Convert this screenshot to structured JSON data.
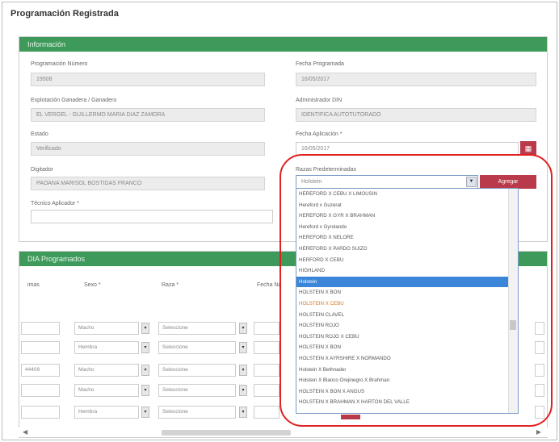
{
  "page_title": "Programación Registrada",
  "panel1_title": "Información",
  "panel2_title": "DIA Programados",
  "fields": {
    "prog_num_label": "Programación Número",
    "prog_num_value": "19508",
    "fecha_prog_label": "Fecha Programada",
    "fecha_prog_value": "16/05/2017",
    "explotacion_label": "Explotación Ganadera / Ganadero",
    "explotacion_value": "EL VERGEL - GUILLERMO MARIA DIAZ ZAMORA",
    "admin_label": "Administrador DIN",
    "admin_value": "IDENTIFICA AUTOTUTORADO",
    "estado_label": "Estado",
    "estado_value": "Verificado",
    "fecha_aplic_label": "Fecha Aplicación *",
    "fecha_aplic_value": "16/05/2017",
    "digitador_label": "Digitador",
    "digitador_value": "PAOANA MARISOL BOSTIDAS FRANCO",
    "razas_label": "Razas Predeterminadas",
    "razas_value": "Holstein",
    "agregar_label": "Agregar",
    "tecnico_label": "Técnico Aplicador *",
    "tecnico_value": ""
  },
  "breed_options": [
    "HEREFORD X CEBU X LIMOUSIN",
    "Hereford x Guzerat",
    "HEREFORD X GYR X BRAHMAN",
    "Hereford x Gyrolando",
    "HEREFORD X NELORE",
    "HEREFORD X PARDO SUIZO",
    "HERFORD X CEBU",
    "HIGHLAND",
    "Holstein",
    "HOLSTEIN X BON",
    "HOLSTEIN X CEBU",
    "HOLSTEIN CLAVEL",
    "HOLSTEIN ROJO",
    "HOLSTEIN ROJO X CEBU",
    "HOLSTEIN X BON",
    "HOLSTEIN X AYRSHIRE X NORMANDO",
    "Holstein X Bethnader",
    "Holstein X Blanco Orejinegro X Brahman",
    "HOLSTEIN X BON X ANGUS",
    "HOLSTEIN X BRAHMAN X HARTON DEL VALLE"
  ],
  "table": {
    "headers": [
      "imas",
      "Sexo *",
      "Raza *",
      "Fecha Na"
    ],
    "rows": [
      {
        "id": "",
        "sexo": "Macho",
        "raza": "Seleccione"
      },
      {
        "id": "",
        "sexo": "Hembra",
        "raza": "Seleccione"
      },
      {
        "id": "44409",
        "sexo": "Macho",
        "raza": "Seleccione"
      },
      {
        "id": "",
        "sexo": "Macho",
        "raza": "Seleccione"
      },
      {
        "id": "",
        "sexo": "Hembra",
        "raza": "Seleccione"
      }
    ]
  },
  "colors": {
    "header_green": "#3e9a5a",
    "button_red": "#b93a4a",
    "selected_blue": "#3b86d8",
    "annotation_red": "#e02020"
  },
  "icons": {
    "calendar": "calendar-icon",
    "dropdown": "chevron-down-icon"
  }
}
